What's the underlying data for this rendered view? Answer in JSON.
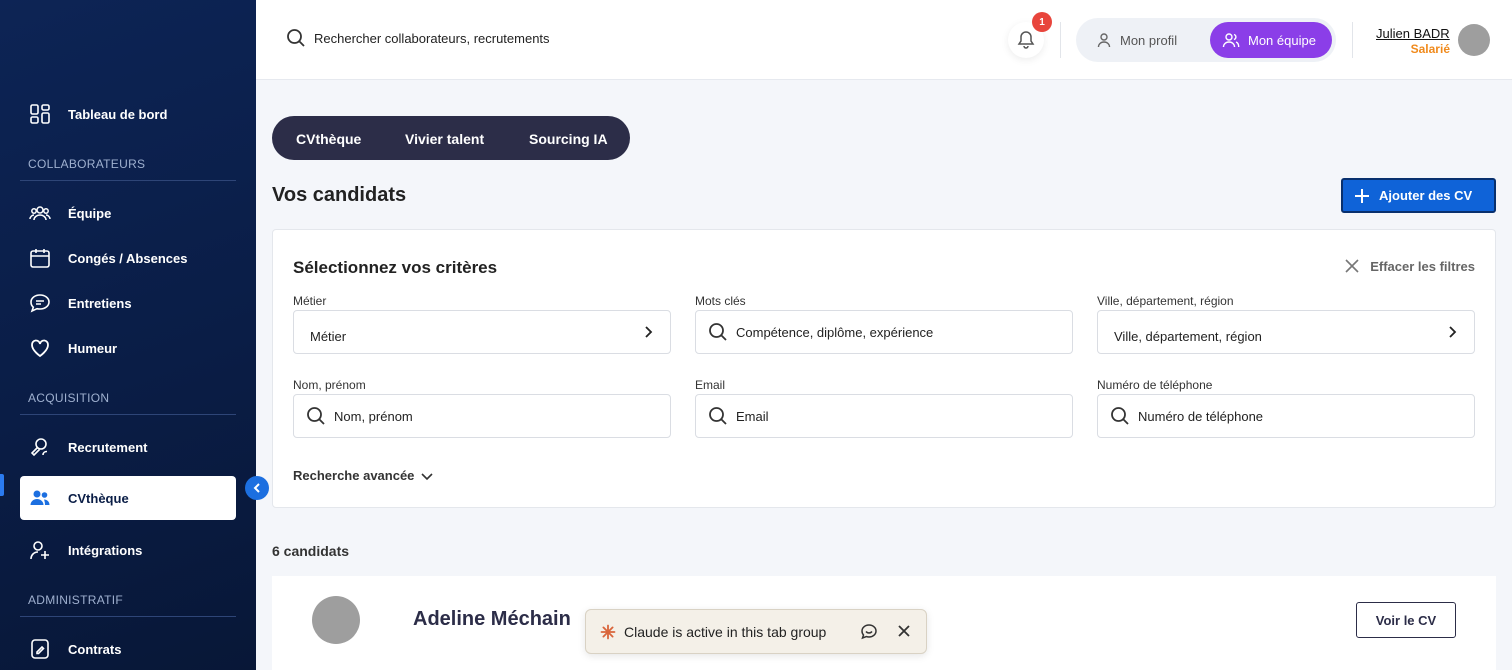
{
  "sidebar": {
    "items": [
      {
        "label": "Tableau de bord",
        "icon": "dashboard-icon"
      },
      {
        "label": "Équipe",
        "icon": "team-icon"
      },
      {
        "label": "Congés / Absences",
        "icon": "calendar-icon"
      },
      {
        "label": "Entretiens",
        "icon": "chat-icon"
      },
      {
        "label": "Humeur",
        "icon": "heart-icon"
      },
      {
        "label": "Recrutement",
        "icon": "recruit-icon"
      },
      {
        "label": "CVthèque",
        "icon": "users-icon"
      },
      {
        "label": "Intégrations",
        "icon": "user-plus-icon"
      },
      {
        "label": "Contrats",
        "icon": "contract-icon"
      }
    ],
    "sections": {
      "collaborateurs": "COLLABORATEURS",
      "acquisition": "ACQUISITION",
      "administratif": "ADMINISTRATIF"
    },
    "active": "CVthèque"
  },
  "header": {
    "search_placeholder": "Rechercher collaborateurs, recrutements",
    "notification_count": "1",
    "profile_label": "Mon profil",
    "team_label": "Mon équipe",
    "user_name": "Julien BADR",
    "user_role": "Salarié"
  },
  "tabs": [
    "CVthèque",
    "Vivier talent",
    "Sourcing IA"
  ],
  "main": {
    "title": "Vos candidats",
    "add_button": "Ajouter des CV"
  },
  "filters": {
    "title": "Sélectionnez vos critères",
    "clear_label": "Effacer les filtres",
    "fields": [
      {
        "label": "Métier",
        "placeholder": "Métier"
      },
      {
        "label": "Mots clés",
        "placeholder": "Compétence, diplôme, expérience"
      },
      {
        "label": "Ville, département, région",
        "placeholder": "Ville, département, région"
      },
      {
        "label": "Nom, prénom",
        "placeholder": "Nom, prénom"
      },
      {
        "label": "Email",
        "placeholder": "Email"
      },
      {
        "label": "Numéro de téléphone",
        "placeholder": "Numéro de téléphone"
      }
    ],
    "advanced_label": "Recherche avancée"
  },
  "results": {
    "count_label": "6 candidats",
    "candidates": [
      {
        "name": "Adeline Méchain",
        "cv_button": "Voir le CV"
      }
    ]
  },
  "claude_bar": {
    "text": "Claude is active in this tab group"
  },
  "colors": {
    "sidebar_bg": "#0a1d46",
    "accent_blue": "#0f63d8",
    "team_purple": "#8b3ee8",
    "role_orange": "#f08a1c",
    "badge_red": "#e8453c",
    "tabs_bg": "#2c2d48"
  }
}
